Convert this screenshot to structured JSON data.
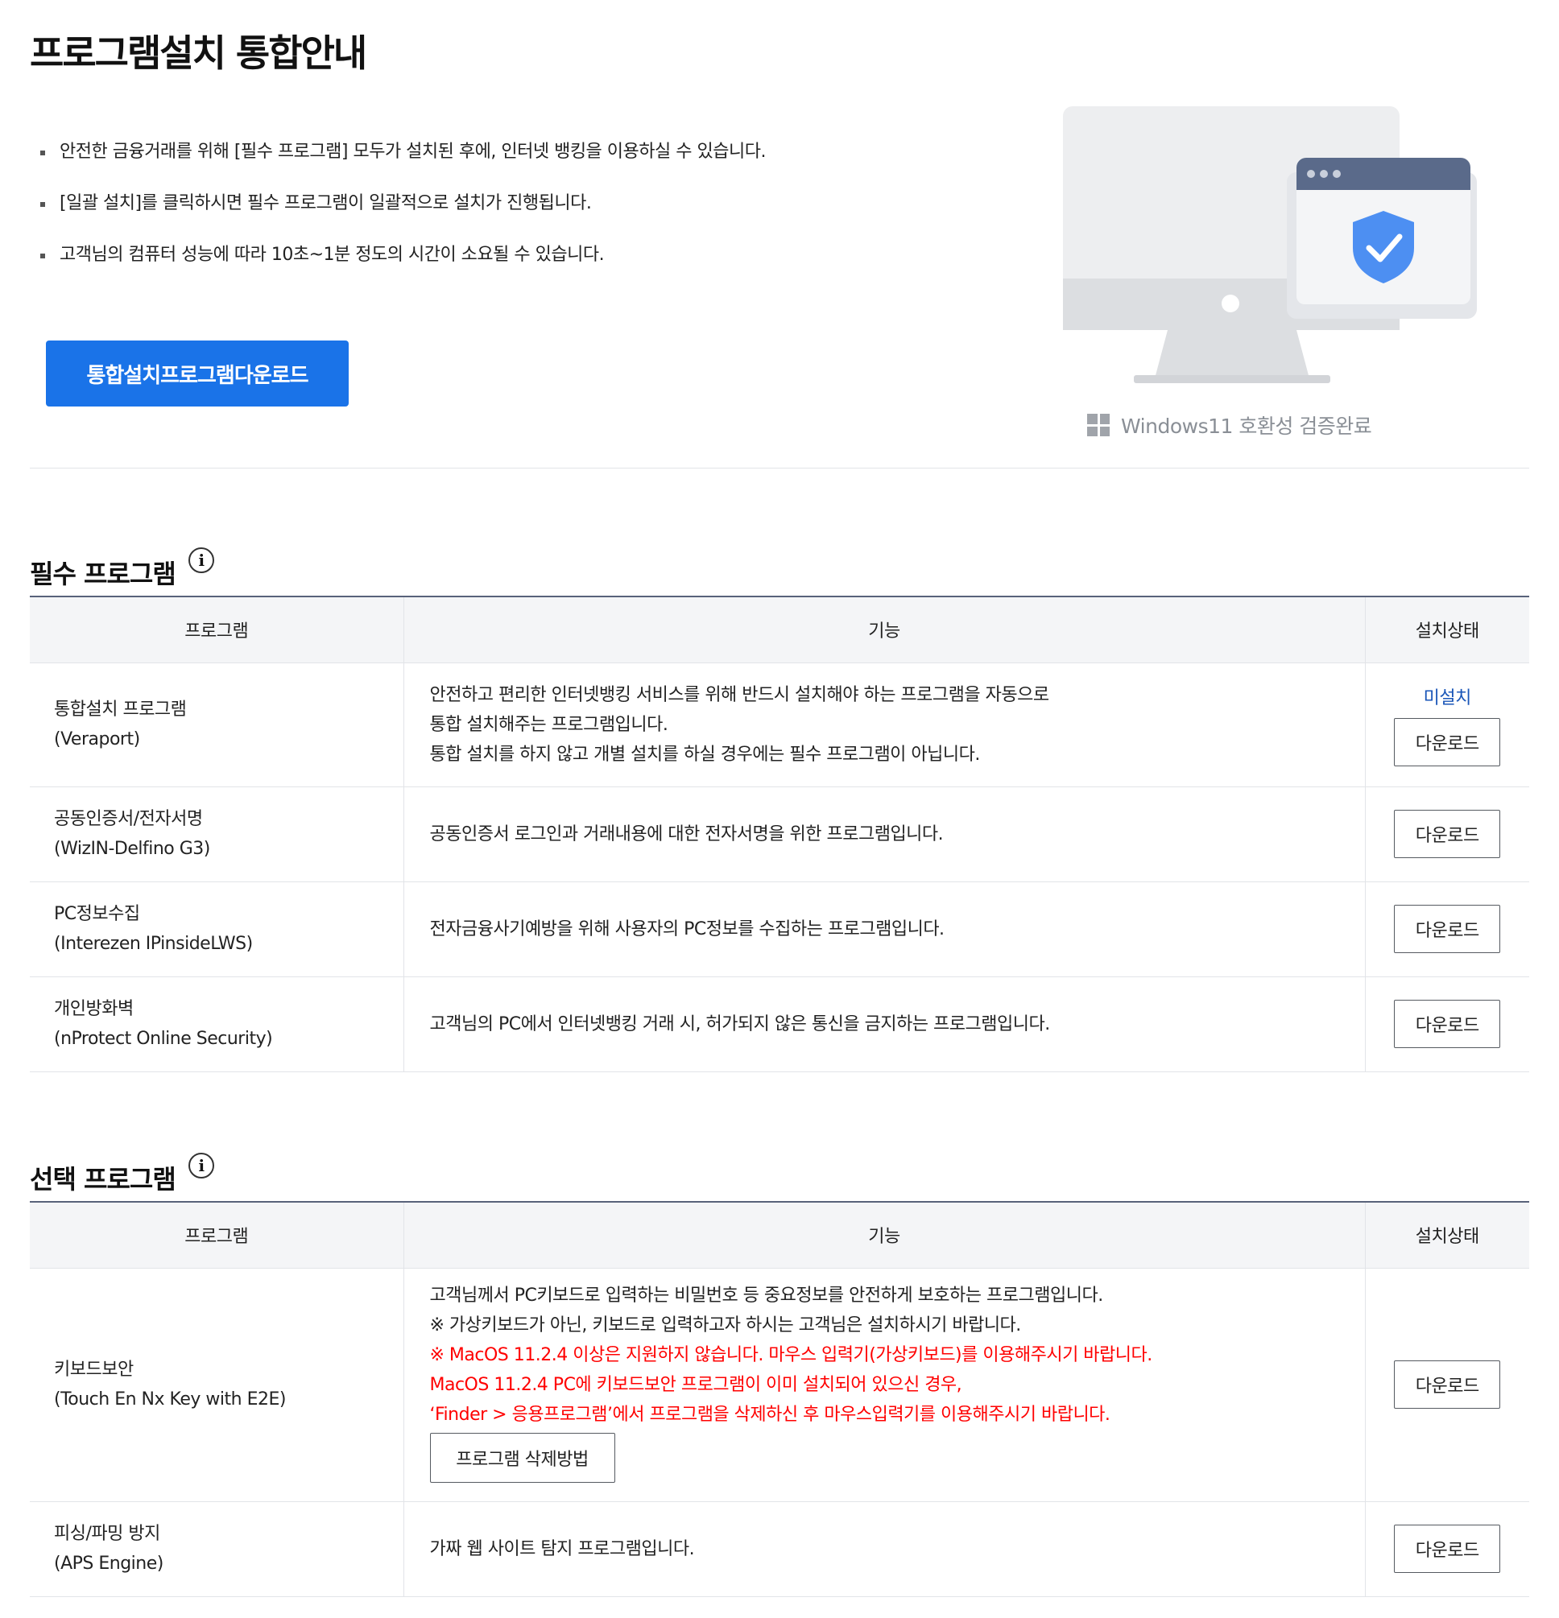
{
  "page": {
    "title": "프로그램설치 통합안내"
  },
  "intro": {
    "items": [
      "안전한 금융거래를 위해 [필수 프로그램] 모두가 설치된 후에, 인터넷 뱅킹을 이용하실 수 있습니다.",
      "[일괄 설치]를 클릭하시면 필수 프로그램이 일괄적으로 설치가 진행됩니다.",
      "고객님의 컴퓨터 성능에 따라 10초~1분 정도의 시간이 소요될 수 있습니다."
    ],
    "download_all_label": "통합설치프로그램다운로드",
    "windows_note": "Windows11 호환성 검증완료"
  },
  "colors": {
    "primary": "#1a73e8",
    "status_link": "#1a56b8",
    "warning": "#ff0000",
    "table_head_bg": "#f4f5f7",
    "table_top_border": "#58627a"
  },
  "icons": {
    "info": "info-circle-icon",
    "windows": "windows-logo-icon",
    "monitor": "monitor-shield-illustration",
    "shield": "shield-check-icon"
  },
  "required": {
    "title": "필수 프로그램",
    "info_glyph": "i",
    "headers": {
      "program": "프로그램",
      "function": "기능",
      "status": "설치상태"
    },
    "rows": [
      {
        "name": "통합설치 프로그램",
        "sub": "(Veraport)",
        "desc": [
          "안전하고 편리한 인터넷뱅킹 서비스를 위해 반드시 설치해야 하는 프로그램을 자동으로",
          "통합 설치해주는 프로그램입니다.",
          "통합 설치를 하지 않고 개별 설치를 하실 경우에는 필수 프로그램이 아닙니다."
        ],
        "status": "미설치",
        "button": "다운로드"
      },
      {
        "name": "공동인증서/전자서명",
        "sub": "(WizIN-Delfino G3)",
        "desc": [
          "공동인증서 로그인과 거래내용에 대한 전자서명을 위한 프로그램입니다."
        ],
        "button": "다운로드"
      },
      {
        "name": "PC정보수집",
        "sub": "(Interezen IPinsideLWS)",
        "desc": [
          "전자금융사기예방을 위해 사용자의 PC정보를 수집하는 프로그램입니다."
        ],
        "button": "다운로드"
      },
      {
        "name": "개인방화벽",
        "sub": "(nProtect Online Security)",
        "desc": [
          "고객님의 PC에서 인터넷뱅킹 거래 시, 허가되지 않은 통신을 금지하는 프로그램입니다."
        ],
        "button": "다운로드"
      }
    ]
  },
  "optional": {
    "title": "선택 프로그램",
    "info_glyph": "i",
    "headers": {
      "program": "프로그램",
      "function": "기능",
      "status": "설치상태"
    },
    "rows": [
      {
        "name": "키보드보안",
        "sub": "(Touch En Nx Key with E2E)",
        "desc": [
          "고객님께서 PC키보드로 입력하는 비밀번호 등 중요정보를 안전하게 보호하는 프로그램입니다.",
          "※ 가상키보드가 아닌, 키보드로 입력하고자 하시는 고객님은 설치하시기 바랍니다."
        ],
        "warnings": [
          "※ MacOS 11.2.4 이상은 지원하지 않습니다. 마우스 입력기(가상키보드)를 이용해주시기 바랍니다.",
          "MacOS 11.2.4 PC에 키보드보안 프로그램이 이미 설치되어 있으신 경우,",
          "‘Finder > 응용프로그램’에서 프로그램을 삭제하신 후 마우스입력기를 이용해주시기 바랍니다."
        ],
        "sub_button": "프로그램 삭제방법",
        "button": "다운로드"
      },
      {
        "name": "피싱/파밍 방지",
        "sub": "(APS Engine)",
        "desc": [
          "가짜 웹 사이트 탐지 프로그램입니다."
        ],
        "button": "다운로드"
      }
    ]
  }
}
